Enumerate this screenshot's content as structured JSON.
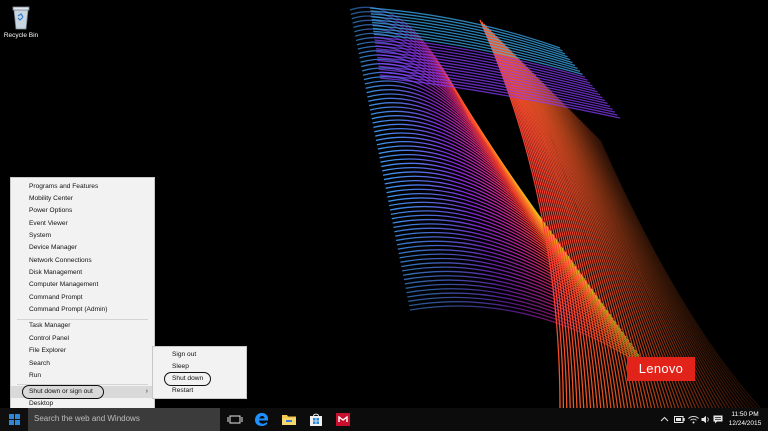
{
  "desktop": {
    "icons": [
      {
        "label": "Recycle Bin",
        "icon": "recycle-bin-icon"
      }
    ],
    "brand_badge": "Lenovo"
  },
  "winx_menu": {
    "group1": [
      "Programs and Features",
      "Mobility Center",
      "Power Options",
      "Event Viewer",
      "System",
      "Device Manager",
      "Network Connections",
      "Disk Management",
      "Computer Management",
      "Command Prompt",
      "Command Prompt (Admin)"
    ],
    "group2": [
      "Task Manager",
      "Control Panel",
      "File Explorer",
      "Search",
      "Run"
    ],
    "group3": [
      "Shut down or sign out",
      "Desktop"
    ],
    "highlighted": "Shut down or sign out"
  },
  "shutdown_submenu": {
    "items": [
      "Sign out",
      "Sleep",
      "Shut down",
      "Restart"
    ],
    "circled": "Shut down"
  },
  "taskbar": {
    "search_placeholder": "Search the web and Windows",
    "pinned_icons": [
      "task-view-icon",
      "edge-icon",
      "file-explorer-icon",
      "store-icon",
      "mcafee-icon"
    ],
    "tray_icons": [
      "chevron-up-icon",
      "battery-icon",
      "wifi-icon",
      "volume-icon",
      "action-center-icon"
    ],
    "clock": {
      "time": "11:50 PM",
      "date": "12/24/2015"
    }
  },
  "colors": {
    "taskbar": "#0c0c0c",
    "search_box": "#3b3b3b",
    "menu_bg": "#f2f2f2",
    "menu_hover": "#d9d9d9",
    "lenovo_red": "#e2231a",
    "edge_blue": "#1e90ff"
  }
}
